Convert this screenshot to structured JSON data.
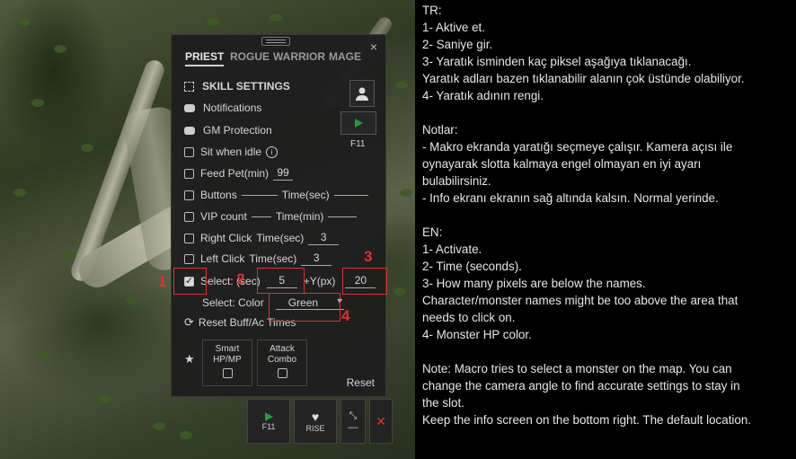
{
  "tabs": [
    "PRIEST",
    "ROGUE",
    "WARRIOR",
    "MAGE"
  ],
  "close_icon": "×",
  "skill_settings": "SKILL SETTINGS",
  "notifications": "Notifications",
  "gm_protection": "GM Protection",
  "sit_when_idle": "Sit when idle",
  "info_icon": "i",
  "play_hotkey": "F11",
  "feed_pet": {
    "label": "Feed Pet(min)",
    "value": "99"
  },
  "buttons": {
    "label": "Buttons",
    "time_label": "Time(sec)",
    "value": "",
    "time": ""
  },
  "vip_count": {
    "label": "VIP count",
    "time_label": "Time(min)",
    "value": "",
    "time": ""
  },
  "right_click": {
    "label": "Right Click",
    "time_label": "Time(sec)",
    "value": "3"
  },
  "left_click": {
    "label": "Left Click",
    "time_label": "Time(sec)",
    "value": "3"
  },
  "select": {
    "label": "Select: (sec)",
    "value": "5",
    "y_label": "+Y(px)",
    "y_value": "20"
  },
  "select_color": {
    "label": "Select: Color",
    "value": "Green"
  },
  "reset_buff": "Reset Buff/Ac Times",
  "smart_hp": "Smart HP/MP",
  "attack_combo": "Attack Combo",
  "reset": "Reset",
  "markers": [
    "1",
    "2",
    "3",
    "4"
  ],
  "bottom_bar": {
    "play": "F11",
    "rise": "RISE"
  },
  "notes": [
    "TR:",
    "1- Aktive et.",
    "2- Saniye gir.",
    "3- Yaratık isminden kaç piksel aşağıya tıklanacağı.",
    "Yaratık adları bazen tıklanabilir alanın çok üstünde olabiliyor.",
    "4- Yaratık adının rengi.",
    "",
    "Notlar:",
    "- Makro ekranda yaratığı seçmeye çalışır. Kamera açısı ile",
    "oynayarak slotta kalmaya engel olmayan en iyi ayarı",
    "bulabilirsiniz.",
    "- Info ekranı ekranın sağ altında kalsın. Normal yerinde.",
    "",
    "EN:",
    "1- Activate.",
    "2- Time (seconds).",
    "3- How many pixels are below the names.",
    "Character/monster names might be too above the area that",
    "needs to click on.",
    "4- Monster HP color.",
    "",
    "Note: Macro tries to select a monster on the map. You can",
    "change the camera angle to find accurate settings to stay in",
    "the slot.",
    "Keep the info screen on the bottom right. The default location."
  ],
  "colors": {
    "accent_green": "#1f9d3a",
    "marker_red": "#e23030",
    "panel_bg": "#1e1e1e"
  }
}
